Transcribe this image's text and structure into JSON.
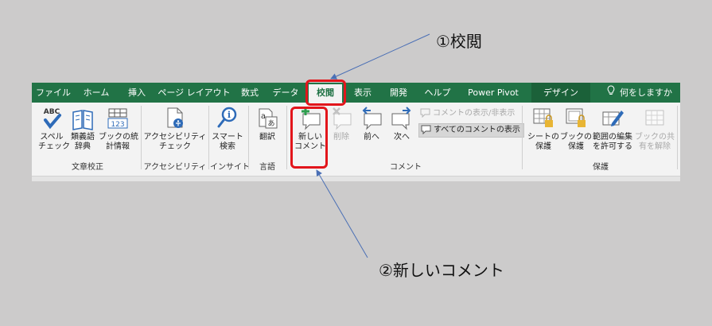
{
  "annotations": {
    "step1": "①校閲",
    "step2": "②新しいコメント"
  },
  "tabs": [
    {
      "label": "ファイル"
    },
    {
      "label": "ホーム"
    },
    {
      "label": "挿入"
    },
    {
      "label": "ページ レイアウト"
    },
    {
      "label": "数式"
    },
    {
      "label": "データ"
    },
    {
      "label": "校閲",
      "active": true
    },
    {
      "label": "表示"
    },
    {
      "label": "開発"
    },
    {
      "label": "ヘルプ"
    },
    {
      "label": "Power Pivot"
    },
    {
      "label": "デザイン"
    },
    {
      "label": "何をしますか"
    }
  ],
  "ribbon": {
    "proofing": {
      "spell_line1": "スペル",
      "spell_line2": "チェック",
      "spell_icon_text": "ABC",
      "thesaurus_line1": "類義語",
      "thesaurus_line2": "辞典",
      "stats_line1": "ブックの統",
      "stats_line2": "計情報",
      "stats_icon_text": "123",
      "group": "文章校正"
    },
    "accessibility": {
      "check_line1": "アクセシビリティ",
      "check_line2": "チェック",
      "group": "アクセシビリティ"
    },
    "insights": {
      "smart_line1": "スマート",
      "smart_line2": "検索",
      "group": "インサイト"
    },
    "language": {
      "translate": "翻訳",
      "group": "言語"
    },
    "comments": {
      "new_line1": "新しい",
      "new_line2": "コメント",
      "delete": "削除",
      "prev": "前へ",
      "next": "次へ",
      "show_hide": "コメントの表示/非表示",
      "show_all": "すべてのコメントの表示",
      "group": "コメント"
    },
    "protect": {
      "sheet_line1": "シートの",
      "sheet_line2": "保護",
      "book_line1": "ブックの",
      "book_line2": "保護",
      "range_line1": "範囲の編集",
      "range_line2": "を許可する",
      "unshare_line1": "ブックの共",
      "unshare_line2": "有を解除",
      "group": "保護"
    }
  },
  "colors": {
    "tab_bar": "#217346",
    "highlight": "#e2151b",
    "arrow": "#4a6fb5"
  }
}
